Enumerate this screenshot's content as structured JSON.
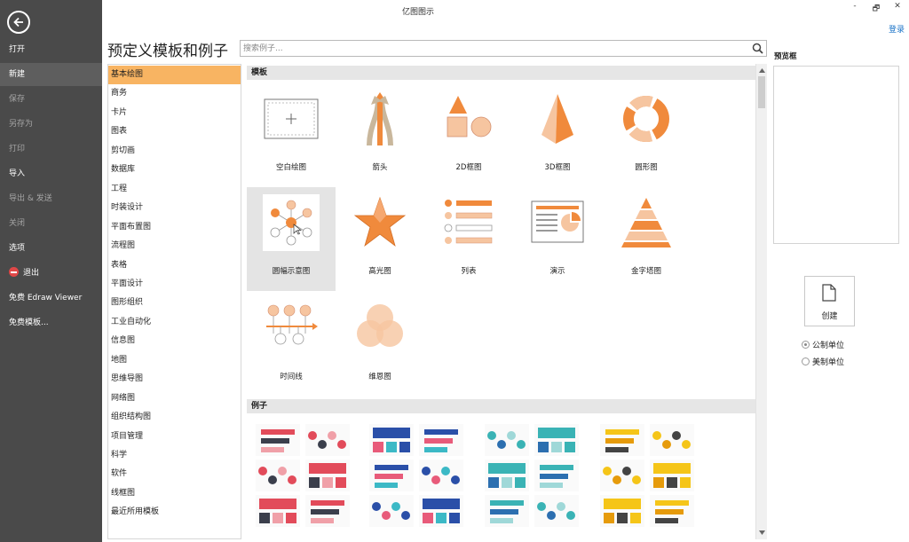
{
  "window": {
    "title": "亿图图示",
    "login": "登录",
    "minimize": "-",
    "restore": "🗗",
    "close": "✕"
  },
  "sidebar": {
    "items": [
      {
        "label": "打开",
        "state": "normal"
      },
      {
        "label": "新建",
        "state": "active"
      },
      {
        "label": "保存",
        "state": "disabled"
      },
      {
        "label": "另存为",
        "state": "disabled"
      },
      {
        "label": "打印",
        "state": "disabled"
      },
      {
        "label": "导入",
        "state": "normal"
      },
      {
        "label": "导出 & 发送",
        "state": "disabled"
      },
      {
        "label": "关闭",
        "state": "disabled"
      },
      {
        "label": "选项",
        "state": "normal"
      },
      {
        "label": "退出",
        "state": "normal",
        "icon": "exit-icon"
      },
      {
        "label": "免费 Edraw Viewer",
        "state": "normal"
      },
      {
        "label": "免费模板...",
        "state": "normal"
      }
    ]
  },
  "page": {
    "title": "预定义模板和例子",
    "search_placeholder": "搜索例子..."
  },
  "categories": {
    "selected": "基本绘图",
    "items": [
      "基本绘图",
      "商务",
      "卡片",
      "图表",
      "剪切画",
      "数据库",
      "工程",
      "时装设计",
      "平面布置图",
      "流程图",
      "表格",
      "平面设计",
      "图形组织",
      "工业自动化",
      "信息图",
      "地图",
      "思维导图",
      "网络图",
      "组织结构图",
      "项目管理",
      "科学",
      "软件",
      "线框图",
      "最近所用模板"
    ]
  },
  "templates": {
    "header": "模板",
    "items": [
      {
        "label": "空白绘图",
        "icon": "blank-drawing-icon"
      },
      {
        "label": "箭头",
        "icon": "arrows-icon"
      },
      {
        "label": "2D框图",
        "icon": "2d-block-icon"
      },
      {
        "label": "3D框图",
        "icon": "3d-block-icon"
      },
      {
        "label": "圆形图",
        "icon": "circular-icon"
      },
      {
        "label": "圆幅示意图",
        "icon": "radial-diagram-icon",
        "selected": true
      },
      {
        "label": "高光图",
        "icon": "highlight-star-icon"
      },
      {
        "label": "列表",
        "icon": "list-icon"
      },
      {
        "label": "演示",
        "icon": "presentation-icon"
      },
      {
        "label": "金字塔图",
        "icon": "pyramid-icon"
      },
      {
        "label": "时间线",
        "icon": "timeline-icon"
      },
      {
        "label": "维恩图",
        "icon": "venn-icon"
      }
    ]
  },
  "examples": {
    "header": "例子"
  },
  "right_panel": {
    "preview_label": "预览框",
    "create_label": "创建",
    "units": [
      {
        "label": "公制单位",
        "checked": true
      },
      {
        "label": "美制单位",
        "checked": false
      }
    ]
  },
  "colors": {
    "accent": "#f8b462",
    "orange": "#f08a3c",
    "sidebar_bg": "#4a4a4a",
    "link": "#1a73c7"
  }
}
